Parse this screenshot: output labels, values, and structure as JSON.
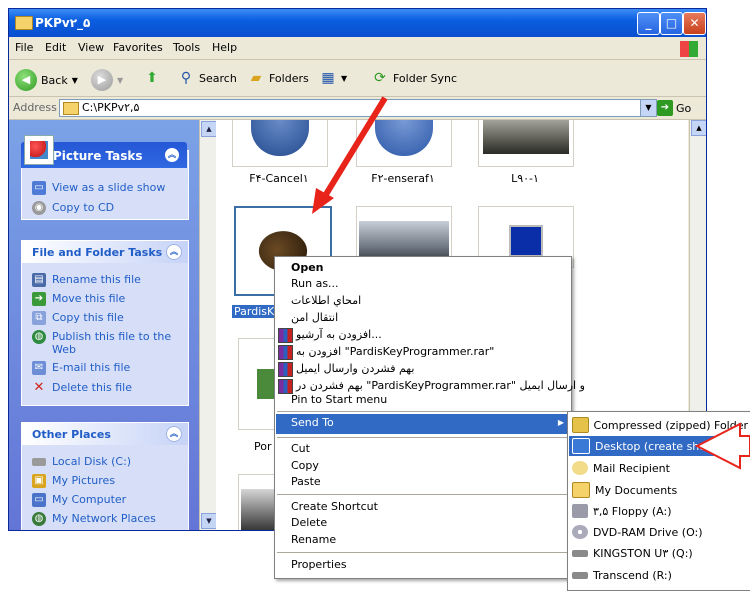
{
  "window": {
    "title": "PKPv۲_۵"
  },
  "menu": [
    "File",
    "Edit",
    "View",
    "Favorites",
    "Tools",
    "Help"
  ],
  "toolbar": {
    "back": "Back",
    "search": "Search",
    "folders": "Folders",
    "folder_sync": "Folder Sync"
  },
  "address": {
    "label": "Address",
    "value": "C:\\PKPv۲,۵",
    "go": "Go"
  },
  "picture_tasks": {
    "title": "Picture Tasks",
    "items": [
      "View as a slide show",
      "Copy to CD"
    ]
  },
  "file_tasks": {
    "title": "File and Folder Tasks",
    "items": [
      "Rename this file",
      "Move this file",
      "Copy this file",
      "Publish this file to the Web",
      "E-mail this file",
      "Delete this file"
    ]
  },
  "other_places": {
    "title": "Other Places",
    "items": [
      "Local Disk (C:)",
      "My Pictures",
      "My Computer",
      "My Network Places"
    ]
  },
  "files": {
    "top": [
      "F۴-Cancel۱",
      "F۲-enseraf۱",
      "L۹۰-۱"
    ],
    "selected": "PardisKeyP",
    "partial": "Por"
  },
  "context_menu": {
    "open": "Open",
    "run_as": "Run as...",
    "rtl1": "امحاي اطلاعات",
    "rtl2": "انتقال امن",
    "rar1": "افزودن به آرشيو...",
    "rar2": "افزودن به \"PardisKeyProgrammer.rar\"",
    "rar3": "بهم فشردن وارسال ايميل",
    "rar4": "بهم فشردن در \"PardisKeyProgrammer.rar\" و ارسال ايميل",
    "pin": "Pin to Start menu",
    "send_to": "Send To",
    "cut": "Cut",
    "copy": "Copy",
    "paste": "Paste",
    "create_shortcut": "Create Shortcut",
    "delete": "Delete",
    "rename": "Rename",
    "properties": "Properties"
  },
  "send_to_menu": [
    "Compressed (zipped) Folder",
    "Desktop (create shortcut)",
    "Mail Recipient",
    "My Documents",
    "۳,۵ Floppy (A:)",
    "DVD-RAM Drive (O:)",
    "KINGSTON U۳ (Q:)",
    "Transcend (R:)"
  ]
}
